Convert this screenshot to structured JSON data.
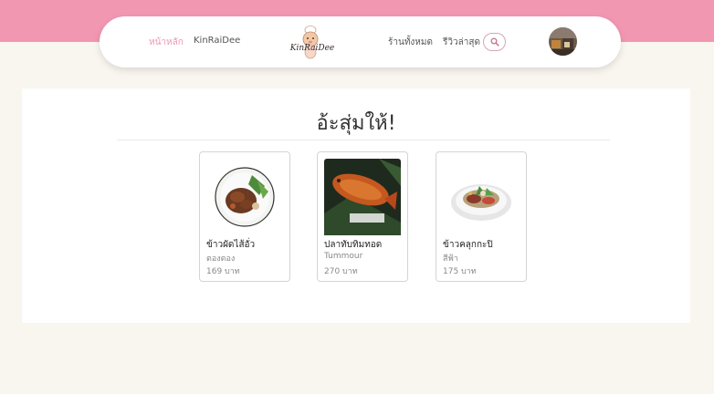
{
  "nav": {
    "home": "หน้าหลัก",
    "kinraidee": "KinRaiDee",
    "logo_text": "KinRaiDee",
    "all_shops": "ร้านทั้งหมด",
    "latest_reviews": "รีวิวล่าสุด"
  },
  "colors": {
    "top_band": "#f197b2",
    "active_link": "#ee98b3",
    "background": "#f9f5ef"
  },
  "section": {
    "title": "อ้ะสุ่มให้!"
  },
  "cards": [
    {
      "name": "ข้าวผัดไส้อั่ว",
      "shop": "ตองตอง",
      "price": "169 บาท"
    },
    {
      "name": "ปลาทับทิมทอด",
      "shop": "Tummour",
      "price": "270 บาท"
    },
    {
      "name": "ข้าวคลุกกะปิ",
      "shop": "สีฟ้า",
      "price": "175 บาท"
    }
  ]
}
